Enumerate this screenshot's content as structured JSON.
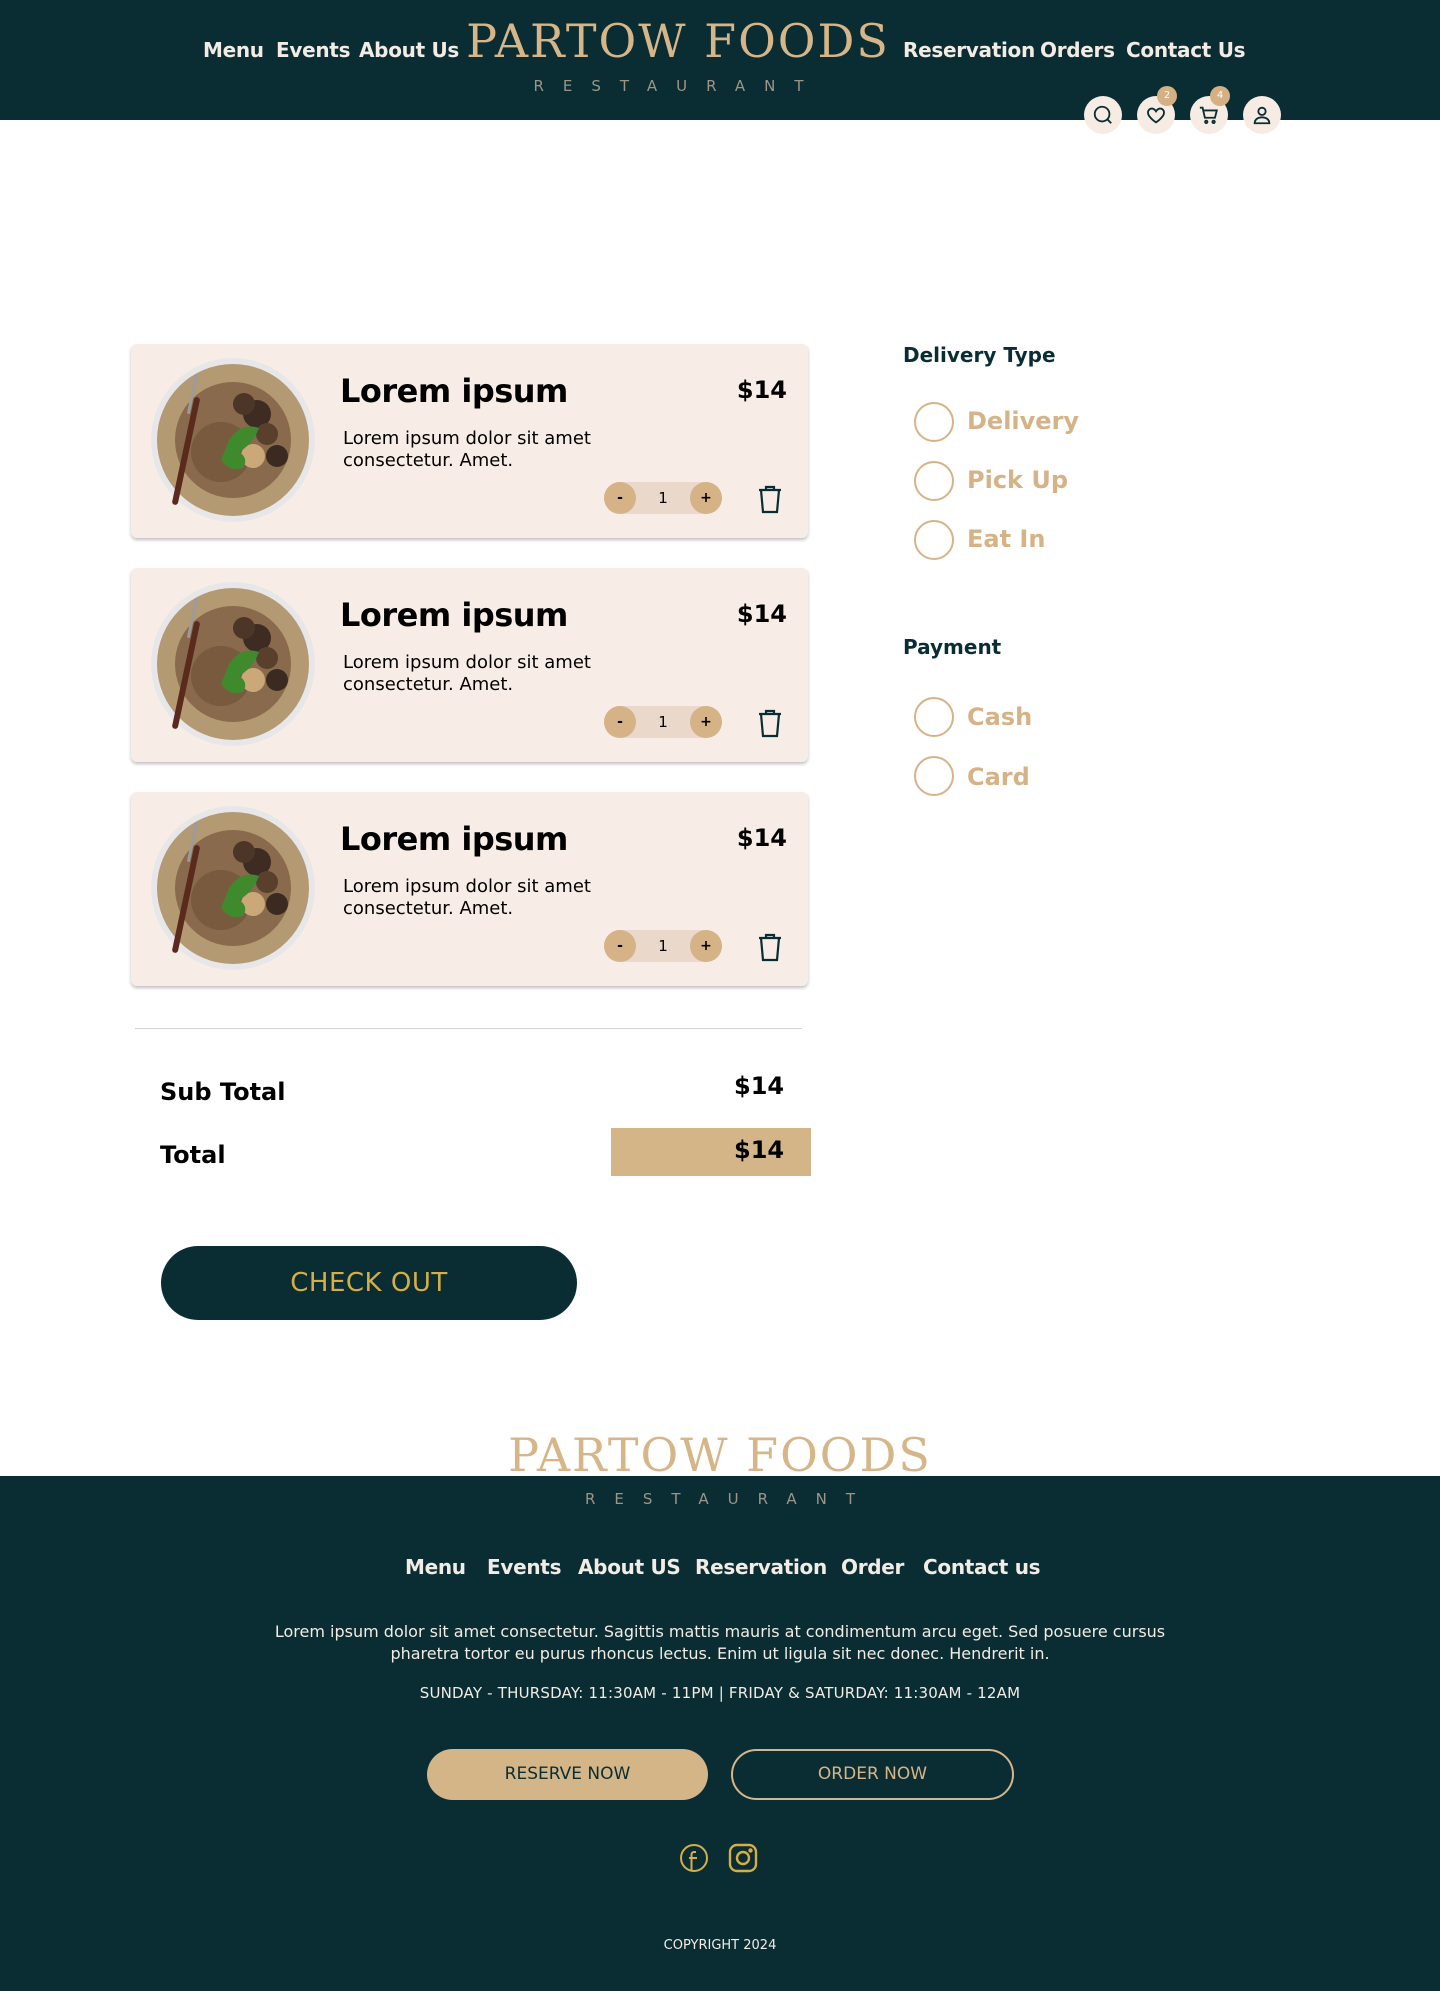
{
  "header": {
    "nav_left": [
      "Menu",
      "Events",
      "About Us"
    ],
    "nav_right": [
      "Reservation",
      "Orders",
      "Contact Us"
    ],
    "logo_main": "PARTOW FOODS",
    "logo_sub": "RESTAURANT",
    "icons": {
      "search": "search-icon",
      "wishlist": "heart-icon",
      "cart": "cart-icon",
      "account": "user-icon"
    },
    "wishlist_count": "2",
    "cart_count": "4"
  },
  "cart": {
    "items": [
      {
        "name": "Lorem ipsum",
        "description": "Lorem ipsum dolor sit amet consectetur. Amet.",
        "price": "$14",
        "quantity": "1",
        "minus": "-",
        "plus": "+"
      },
      {
        "name": "Lorem ipsum",
        "description": "Lorem ipsum dolor sit amet consectetur. Amet.",
        "price": "$14",
        "quantity": "1",
        "minus": "-",
        "plus": "+"
      },
      {
        "name": "Lorem ipsum",
        "description": "Lorem ipsum dolor sit amet consectetur. Amet.",
        "price": "$14",
        "quantity": "1",
        "minus": "-",
        "plus": "+"
      }
    ],
    "subtotal_label": "Sub Total",
    "subtotal_value": "$14",
    "total_label": "Total",
    "total_value": "$14",
    "checkout_label": "CHECK OUT"
  },
  "delivery": {
    "title": "Delivery Type",
    "options": [
      "Delivery",
      "Pick Up",
      "Eat In"
    ]
  },
  "payment": {
    "title": "Payment",
    "options": [
      "Cash",
      "Card"
    ]
  },
  "footer": {
    "logo_main": "PARTOW FOODS",
    "logo_sub": "RESTAURANT",
    "nav": [
      "Menu",
      "Events",
      "About US",
      "Reservation",
      "Order",
      "Contact us"
    ],
    "text": "Lorem ipsum dolor sit amet consectetur. Sagittis mattis mauris at condimentum arcu eget. Sed posuere cursus pharetra tortor eu purus rhoncus lectus. Enim ut ligula sit nec donec. Hendrerit in.",
    "hours": "SUNDAY - THURSDAY: 11:30AM - 11PM | FRIDAY & SATURDAY: 11:30AM - 12AM",
    "reserve_label": "RESERVE NOW",
    "order_label": "ORDER NOW",
    "social": [
      "facebook-icon",
      "instagram-icon"
    ],
    "copyright": "COPYRIGHT 2024"
  },
  "colors": {
    "primary": "#0a2d33",
    "accent": "#d4b588",
    "card_bg": "#f8ede6",
    "checkout_text": "#d6ae45"
  }
}
